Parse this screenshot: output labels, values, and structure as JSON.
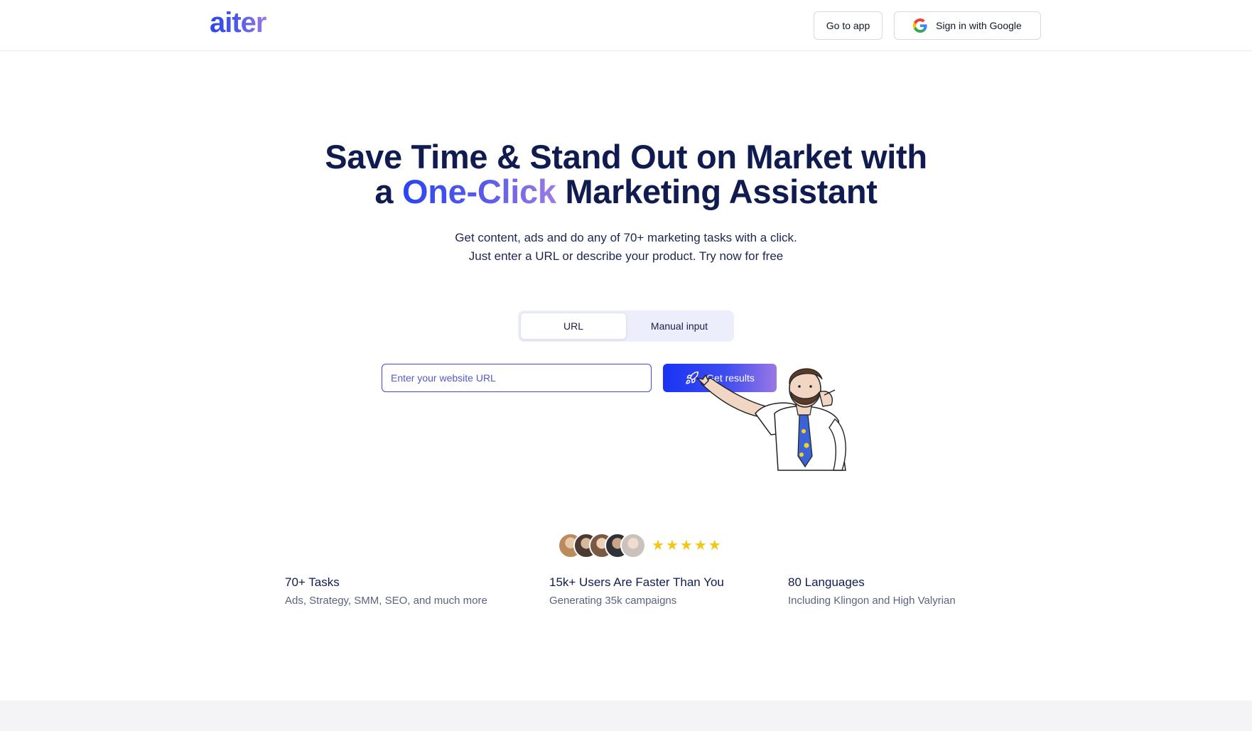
{
  "header": {
    "logo": "aiter",
    "go_to_app": "Go to app",
    "sign_in": "Sign in with Google"
  },
  "hero": {
    "title_line1": "Save Time & Stand Out on Market with",
    "title_line2_pre": "a",
    "title_line2_accent": "One-Click",
    "title_line2_post": "Marketing Assistant",
    "subtitle_line1": "Get content, ads and do any of 70+ marketing tasks with a click.",
    "subtitle_line2": "Just enter a URL or describe your product. Try now for free"
  },
  "input_mode": {
    "options": [
      "URL",
      "Manual input"
    ],
    "selected": "URL"
  },
  "url_form": {
    "placeholder": "Enter your website URL",
    "value": "",
    "submit_label": "Get results"
  },
  "rating": {
    "stars": 5,
    "star_glyph": "★",
    "avatar_count": 5
  },
  "stats": [
    {
      "title": "70+ Tasks",
      "subtitle": "Ads, Strategy, SMM, SEO, and much more"
    },
    {
      "title": "15k+ Users Are Faster Than You",
      "subtitle": "Generating 35k campaigns"
    },
    {
      "title": "80 Languages",
      "subtitle": "Including Klingon and High Valyrian"
    }
  ],
  "colors": {
    "accent_start": "#1934f2",
    "accent_end": "#9a78e4",
    "heading": "#101c50",
    "star": "#f5c518"
  },
  "icons": [
    "google-icon",
    "rocket-icon"
  ]
}
